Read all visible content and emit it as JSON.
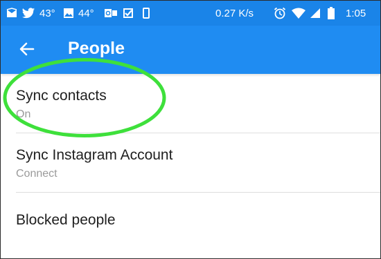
{
  "status_bar": {
    "temp_1": "43°",
    "temp_2": "44°",
    "network_speed": "0.27 K/s",
    "time": "1:05"
  },
  "app_bar": {
    "title": "People",
    "back_icon": "arrow-back-icon"
  },
  "settings": [
    {
      "title": "Sync contacts",
      "subtitle": "On"
    },
    {
      "title": "Sync Instagram Account",
      "subtitle": "Connect"
    },
    {
      "title": "Blocked people"
    }
  ],
  "colors": {
    "status_bar_bg": "#1a84e8",
    "app_bar_bg": "#1f8cf2",
    "highlight": "#3ee03b"
  }
}
